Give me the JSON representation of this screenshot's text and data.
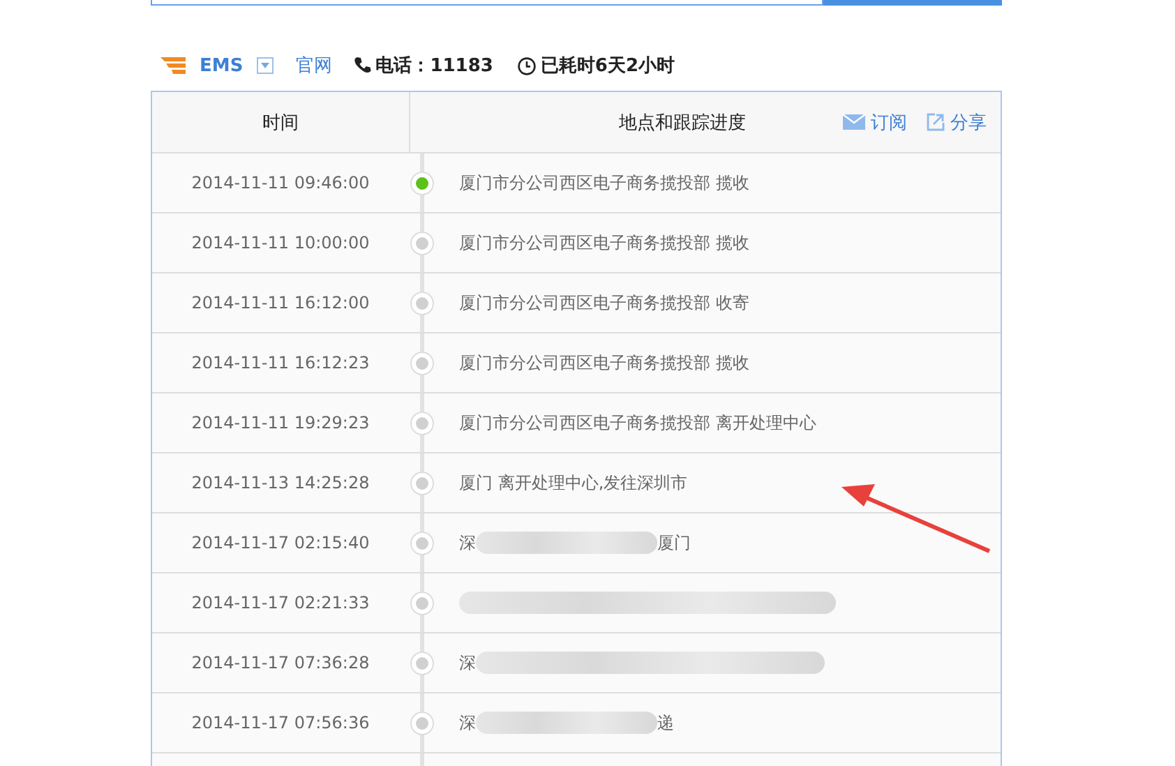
{
  "carrier": {
    "name": "EMS",
    "website_link": "官网",
    "phone": "电话：11183",
    "elapsed": "已耗时6天2小时"
  },
  "table": {
    "columns": [
      "时间",
      "地点和跟踪进度"
    ],
    "actions": [
      {
        "kind": "subscribe",
        "label": "订阅"
      },
      {
        "kind": "share",
        "label": "分享"
      }
    ],
    "rows": [
      {
        "time": "2014-11-11 09:46:00",
        "location": "厦门市分公司西区电子商务揽投部 揽收",
        "highlighted": true,
        "blurred": false
      },
      {
        "time": "2014-11-11 10:00:00",
        "location": "厦门市分公司西区电子商务揽投部 揽收",
        "highlighted": false,
        "blurred": false
      },
      {
        "time": "2014-11-11 16:12:00",
        "location": "厦门市分公司西区电子商务揽投部 收寄",
        "highlighted": false,
        "blurred": false
      },
      {
        "time": "2014-11-11 16:12:23",
        "location": "厦门市分公司西区电子商务揽投部 揽收",
        "highlighted": false,
        "blurred": false
      },
      {
        "time": "2014-11-11 19:29:23",
        "location": "厦门市分公司西区电子商务揽投部 离开处理中心",
        "highlighted": false,
        "blurred": false
      },
      {
        "time": "2014-11-13 14:25:28",
        "location": "厦门 离开处理中心,发往深圳市",
        "highlighted": false,
        "blurred": false
      },
      {
        "time": "2014-11-17 02:15:40",
        "location": "深",
        "location_tail": "厦门",
        "highlighted": false,
        "blurred": true
      },
      {
        "time": "2014-11-17 02:21:33",
        "highlighted": false,
        "blurred": true
      },
      {
        "time": "2014-11-17 07:36:28",
        "location": "深",
        "highlighted": false,
        "blurred": true
      },
      {
        "time": "2014-11-17 07:56:36",
        "location": "深",
        "location_tail": "递",
        "highlighted": false,
        "blurred": true
      }
    ]
  }
}
